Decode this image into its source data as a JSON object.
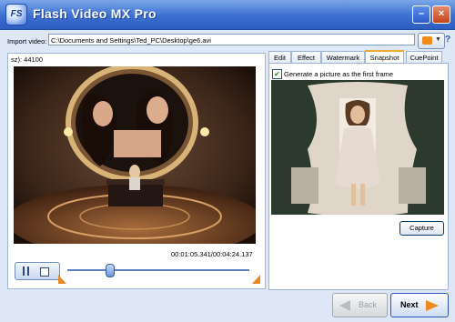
{
  "window": {
    "title": "Flash Video MX Pro",
    "logo_text": "FS",
    "minimize_label": "–",
    "close_label": "×"
  },
  "import": {
    "label": "Import video:",
    "path": "C:\\Documents and Settings\\Ted_PC\\Desktop\\ge6.avi",
    "help": "?"
  },
  "preview": {
    "sample_rate_label": "sz): 44100",
    "time": "00:01:05.341/00:04:24.137",
    "seek_progress": 0.23
  },
  "tabs": [
    {
      "label": "Edit"
    },
    {
      "label": "Effect"
    },
    {
      "label": "Watermark"
    },
    {
      "label": "Snapshot",
      "active": true
    },
    {
      "label": "CuePoint"
    }
  ],
  "snapshot": {
    "checkbox_label": "Generate a picture as the first frame",
    "checked": true,
    "check_glyph": "✔",
    "capture_label": "Capture"
  },
  "footer": {
    "back_label": "Back",
    "next_label": "Next"
  },
  "colors": {
    "titlebar": "#3b6fd0",
    "accent": "#ec8a1e",
    "panel_bg": "#dde7f6"
  }
}
